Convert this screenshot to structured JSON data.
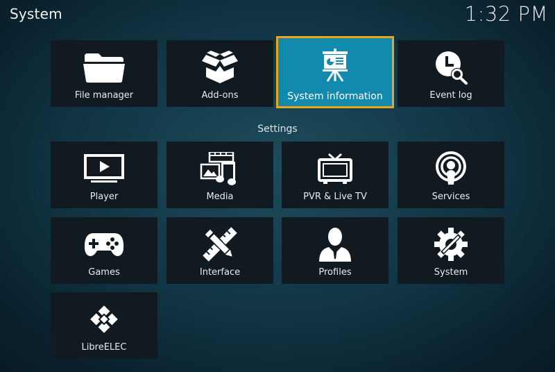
{
  "header": {
    "title": "System",
    "clock": "1:32 PM"
  },
  "top_tiles": [
    {
      "label": "File manager",
      "icon": "folder-icon"
    },
    {
      "label": "Add-ons",
      "icon": "open-box-icon"
    },
    {
      "label": "System information",
      "icon": "presentation-board-icon",
      "selected": true
    },
    {
      "label": "Event log",
      "icon": "clock-search-icon"
    }
  ],
  "settings_label": "Settings",
  "settings_tiles": [
    {
      "label": "Player",
      "icon": "player-screen-icon"
    },
    {
      "label": "Media",
      "icon": "media-icon"
    },
    {
      "label": "PVR & Live TV",
      "icon": "tv-icon"
    },
    {
      "label": "Services",
      "icon": "broadcast-icon"
    },
    {
      "label": "Games",
      "icon": "gamepad-icon"
    },
    {
      "label": "Interface",
      "icon": "pencil-ruler-icon"
    },
    {
      "label": "Profiles",
      "icon": "user-profile-icon"
    },
    {
      "label": "System",
      "icon": "gear-wrench-icon"
    },
    {
      "label": "LibreELEC",
      "icon": "libreelec-logo-icon"
    }
  ],
  "colors": {
    "accent": "#118aad",
    "focus_border": "#f0a21a",
    "tile_bg": "#111a20"
  }
}
